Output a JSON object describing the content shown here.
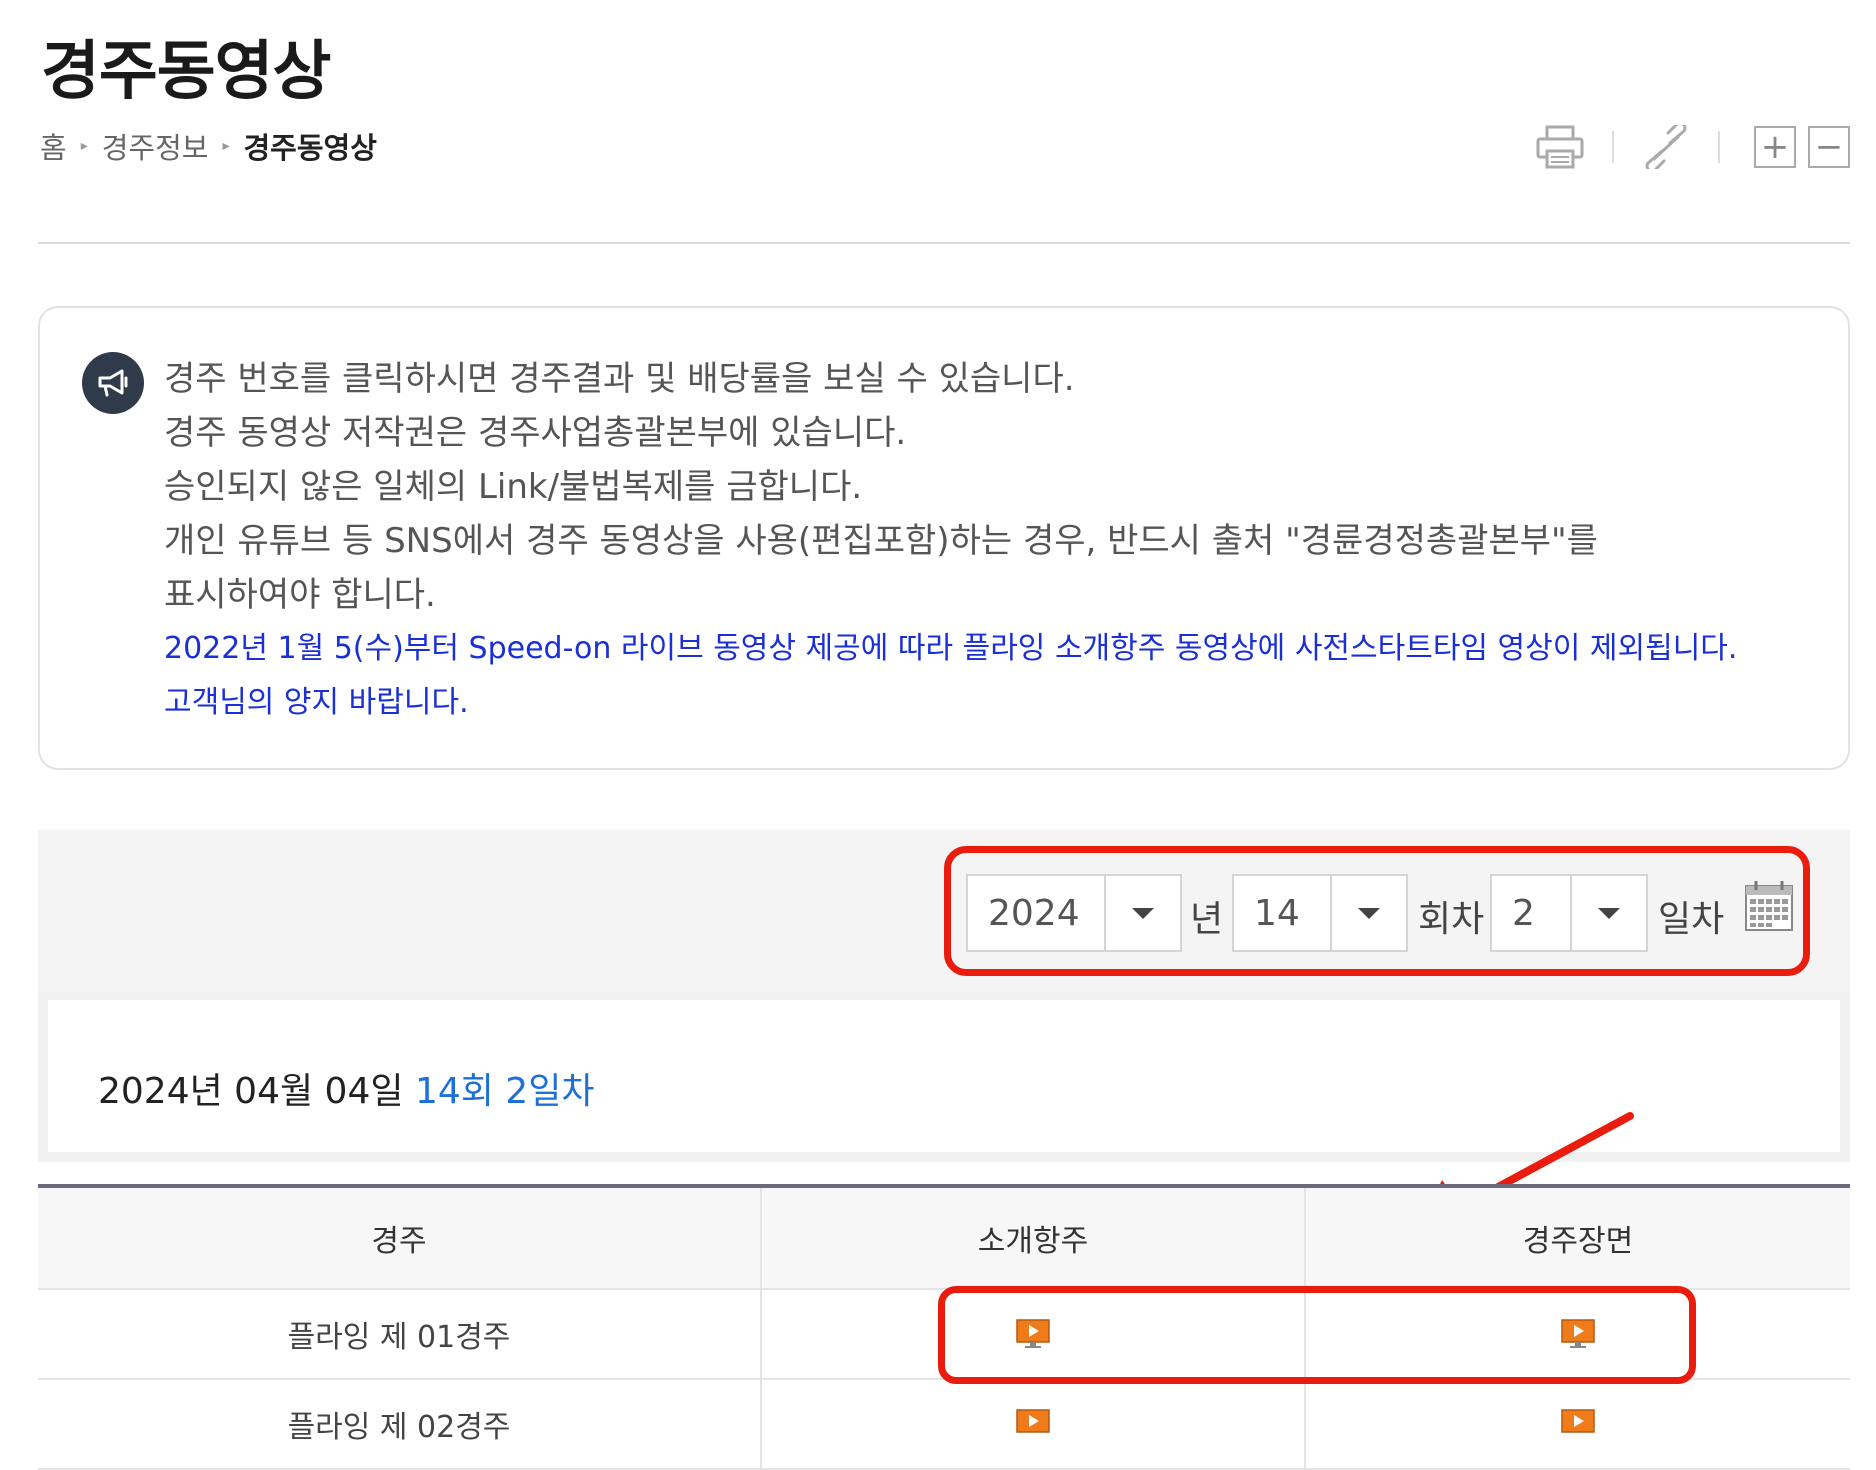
{
  "page": {
    "title": "경주동영상",
    "breadcrumb": [
      "홈",
      "경주정보",
      "경주동영상"
    ]
  },
  "tools": {
    "print_icon": "printer-icon",
    "link_icon": "link-icon",
    "zoom_in_label": "+",
    "zoom_out_label": "−"
  },
  "notice": {
    "icon": "megaphone-icon",
    "lines": [
      "경주 번호를 클릭하시면 경주결과 및 배당률을 보실 수 있습니다.",
      "경주 동영상 저작권은 경주사업총괄본부에 있습니다.",
      "승인되지 않은 일체의 Link/불법복제를 금합니다.",
      "개인 유튜브 등 SNS에서 경주 동영상을 사용(편집포함)하는 경우, 반드시 출처 \"경륜경정총괄본부\"를",
      "표시하여야 합니다."
    ],
    "highlight_lines": [
      "2022년 1월 5(수)부터 Speed-on 라이브 동영상 제공에 따라 플라잉 소개항주 동영상에 사전스타트타임 영상이 제외됩니다.",
      "고객님의 양지 바랍니다."
    ]
  },
  "filter": {
    "year": "2024",
    "year_unit": "년",
    "round": "14",
    "round_unit": "회차",
    "day": "2",
    "day_unit": "일차",
    "calendar_icon": "calendar-icon"
  },
  "date_header": {
    "date": "2024년 04월 04일",
    "round_day": "14회 2일차"
  },
  "table": {
    "headers": [
      "경주",
      "소개항주",
      "경주장면"
    ],
    "rows": [
      {
        "race": "플라잉 제 01경주",
        "intro_icon": "video-icon",
        "scene_icon": "video-icon"
      },
      {
        "race": "플라잉 제 02경주",
        "intro_icon": "video-icon",
        "scene_icon": "video-icon"
      }
    ]
  },
  "colors": {
    "annotation_red": "#ea1c0d",
    "notice_blue": "#1a2fd6",
    "round_blue": "#1e6fd6",
    "video_icon_orange": "#f07b1a"
  }
}
